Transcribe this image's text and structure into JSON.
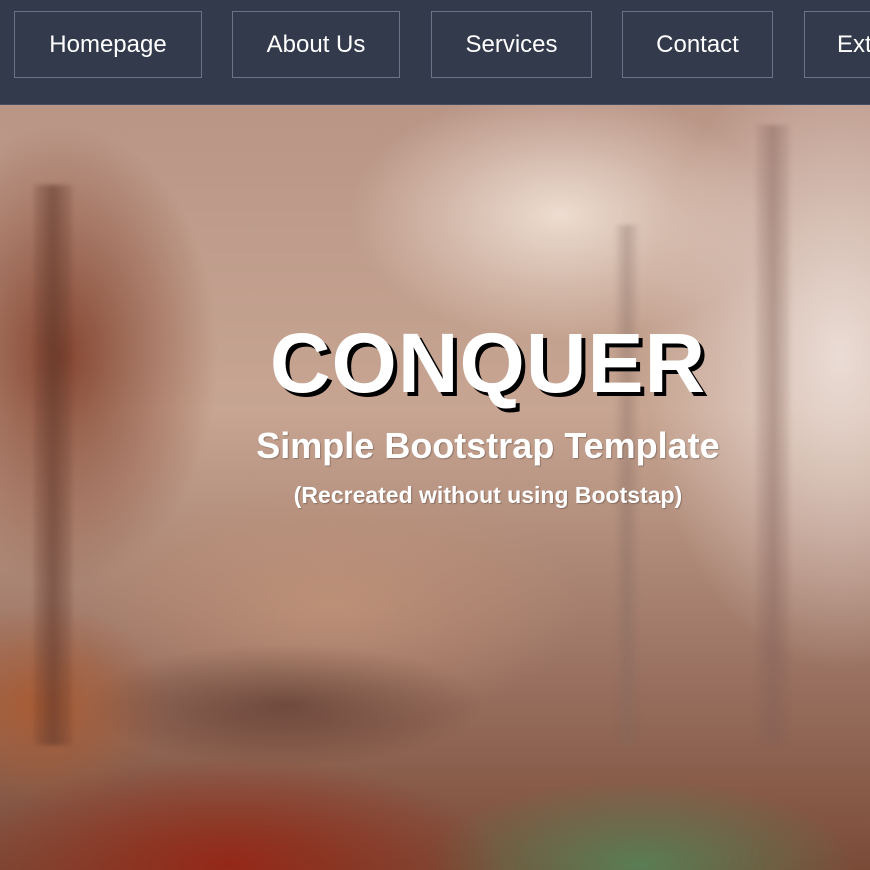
{
  "nav": {
    "items": [
      {
        "label": "Homepage"
      },
      {
        "label": "About Us"
      },
      {
        "label": "Services"
      },
      {
        "label": "Contact"
      },
      {
        "label": "Ext"
      }
    ]
  },
  "hero": {
    "title": "CONQUER",
    "subtitle": "Simple Bootstrap Template",
    "note": "(Recreated without using Bootstap)"
  },
  "colors": {
    "navbar": "#323a4c",
    "nav_border": "#6b7386",
    "text": "#ffffff",
    "title_shadow": "#000000"
  }
}
